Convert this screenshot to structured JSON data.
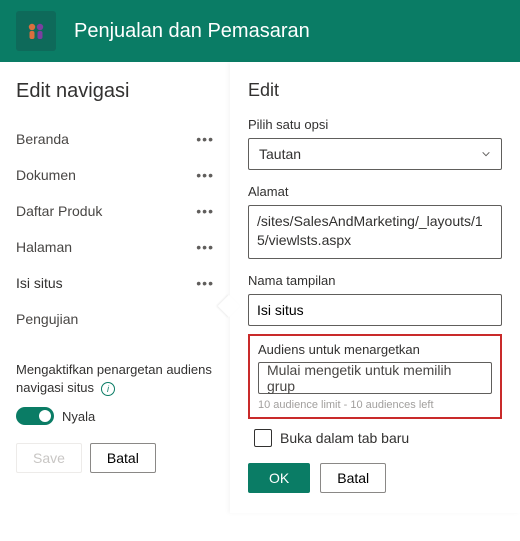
{
  "header": {
    "site_title": "Penjualan dan Pemasaran"
  },
  "left": {
    "title": "Edit navigasi",
    "nav_items": [
      {
        "label": "Beranda"
      },
      {
        "label": "Dokumen"
      },
      {
        "label": "Daftar Produk"
      },
      {
        "label": "Halaman"
      },
      {
        "label": "Isi situs",
        "selected": true
      },
      {
        "label": "Pengujian"
      }
    ],
    "toggle_label": "Mengaktifkan penargetan audiens navigasi situs",
    "toggle_on": "Nyala",
    "save": "Save",
    "cancel": "Batal"
  },
  "right": {
    "title": "Edit",
    "option_label": "Pilih satu opsi",
    "option_value": "Tautan",
    "address_label": "Alamat",
    "address_value": "/sites/SalesAndMarketing/_layouts/15/viewlsts.aspx",
    "display_name_label": "Nama tampilan",
    "display_name_value": "Isi situs",
    "audience_label": "Audiens untuk menargetkan",
    "audience_placeholder": "Mulai mengetik untuk memilih grup",
    "audience_hint": "10 audience limit - 10 audiences left",
    "open_new_tab": "Buka dalam tab baru",
    "ok": "OK",
    "cancel": "Batal"
  }
}
